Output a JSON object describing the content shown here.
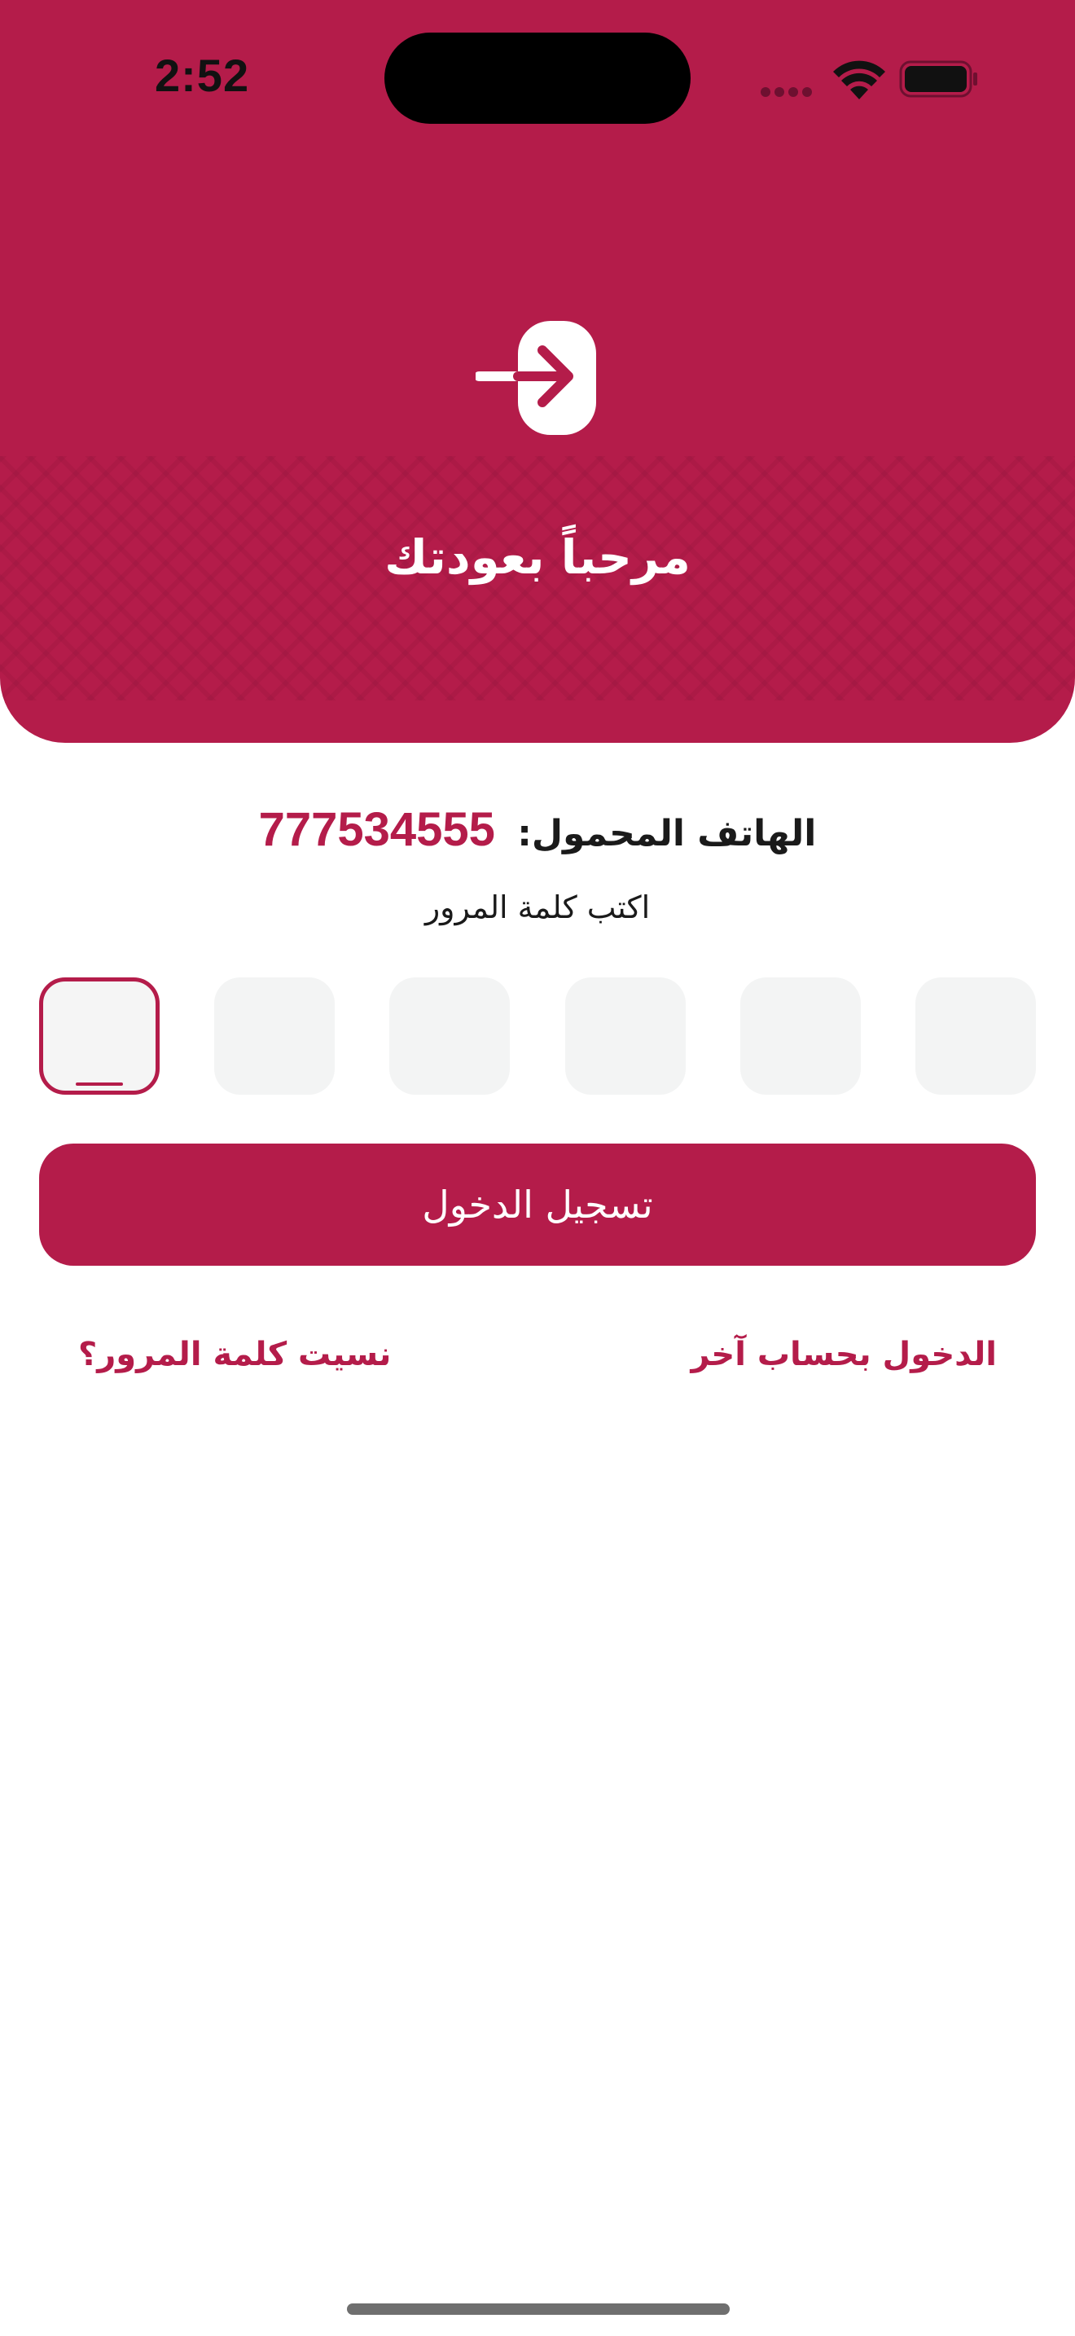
{
  "status_bar": {
    "time": "2:52",
    "colors": {
      "icons": "#111111",
      "signal_dots": "#6e1030"
    }
  },
  "header": {
    "title": "مرحباً بعودتك",
    "icon": "login-arrow-icon",
    "background_color": "#b41c4a"
  },
  "account": {
    "phone_label": "الهاتف المحمول:",
    "phone_number": "777534555"
  },
  "password": {
    "prompt": "اكتب كلمة المرور",
    "digits_count_visible": 6,
    "active_index": 6
  },
  "actions": {
    "login_label": "تسجيل الدخول",
    "other_account_label": "الدخول بحساب آخر",
    "forgot_password_label": "نسيت كلمة المرور؟"
  },
  "theme": {
    "accent": "#b41c4a",
    "pin_background": "#f3f4f4",
    "text": "#1a1a1a"
  }
}
